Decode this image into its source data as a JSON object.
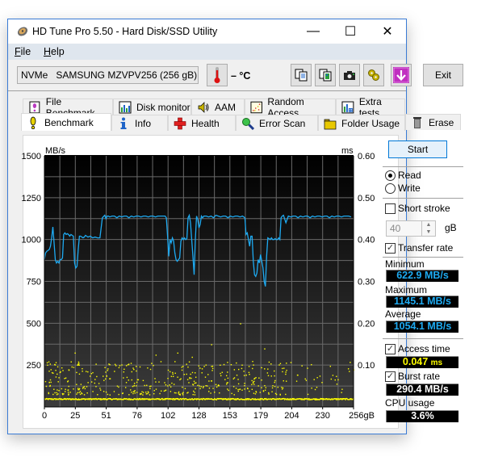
{
  "window": {
    "title": "HD Tune Pro 5.50 - Hard Disk/SSD Utility",
    "controls": {
      "minimize": "—",
      "maximize": "☐",
      "close": "✕"
    }
  },
  "menu": [
    {
      "label": "File",
      "accel": "F",
      "rest": "ile"
    },
    {
      "label": "Help",
      "accel": "H",
      "rest": "elp"
    }
  ],
  "toolbar": {
    "drive": "NVMe   SAMSUNG MZVPV256 (256 gB)",
    "temperature": "– °C",
    "icons": [
      "copy-text-icon",
      "copy-screenshot-icon",
      "camera-icon",
      "options-icon",
      "save-download-icon"
    ],
    "exit_label": "Exit"
  },
  "tabs": {
    "row1": [
      {
        "label": "File Benchmark",
        "icon": "file-benchmark-icon"
      },
      {
        "label": "Disk monitor",
        "icon": "disk-monitor-icon"
      },
      {
        "label": "AAM",
        "icon": "speaker-icon"
      },
      {
        "label": "Random Access",
        "icon": "random-access-icon"
      },
      {
        "label": "Extra tests",
        "icon": "extra-tests-icon"
      }
    ],
    "row2": [
      {
        "label": "Benchmark",
        "icon": "benchmark-icon",
        "active": true
      },
      {
        "label": "Info",
        "icon": "info-icon"
      },
      {
        "label": "Health",
        "icon": "health-cross-icon"
      },
      {
        "label": "Error Scan",
        "icon": "magnifier-icon"
      },
      {
        "label": "Folder Usage",
        "icon": "folder-icon"
      },
      {
        "label": "Erase",
        "icon": "trash-icon"
      }
    ]
  },
  "panel": {
    "start_label": "Start",
    "read_label": "Read",
    "write_label": "Write",
    "mode": "Read",
    "short_stroke_label": "Short stroke",
    "short_stroke_checked": false,
    "short_stroke_value": "40",
    "short_stroke_unit": "gB",
    "transfer_rate_label": "Transfer rate",
    "transfer_rate_checked": true,
    "minimum_label": "Minimum",
    "minimum_value": "622.9 MB/s",
    "maximum_label": "Maximum",
    "maximum_value": "1145.1 MB/s",
    "average_label": "Average",
    "average_value": "1054.1 MB/s",
    "access_time_label": "Access time",
    "access_time_checked": true,
    "access_time_value": "0.047",
    "access_time_unit": "ms",
    "burst_rate_label": "Burst rate",
    "burst_rate_checked": true,
    "burst_rate_value": "290.4 MB/s",
    "cpu_usage_label": "CPU usage",
    "cpu_usage_value": "3.6%"
  },
  "chart_data": {
    "type": "line",
    "title": "",
    "xlabel": "gB",
    "ylabel": "MB/s",
    "y2label": "ms",
    "xlim": [
      0,
      256
    ],
    "ylim": [
      0,
      1500
    ],
    "y2lim": [
      0,
      0.6
    ],
    "x_ticks": [
      "0",
      "25",
      "51",
      "76",
      "102",
      "128",
      "153",
      "179",
      "204",
      "230",
      "256gB"
    ],
    "x_tick_values": [
      0,
      25.6,
      51.2,
      76.8,
      102.4,
      128,
      153.6,
      179.2,
      204.8,
      230.4,
      256
    ],
    "y_ticks": [
      "1500",
      "1250",
      "1000",
      "750",
      "500",
      "250"
    ],
    "y_tick_values": [
      1500,
      1250,
      1000,
      750,
      500,
      250
    ],
    "y2_ticks": [
      "0.60",
      "0.50",
      "0.40",
      "0.30",
      "0.20",
      "0.10"
    ],
    "y2_tick_values": [
      0.6,
      0.5,
      0.4,
      0.3,
      0.2,
      0.1
    ],
    "grid": true,
    "colors": {
      "transfer": "#1eaaf1",
      "access": "#ffff00",
      "bg_top": "#000000",
      "bg_bottom": "#3a3a3a",
      "grid": "#6a6a6a"
    },
    "series": [
      {
        "name": "Transfer rate (MB/s)",
        "x": [
          0,
          1,
          2,
          3,
          4,
          5,
          6,
          7,
          8,
          9,
          10,
          11,
          12,
          13,
          14,
          15,
          16,
          17,
          18,
          19,
          20,
          21,
          22,
          23,
          24,
          25,
          26,
          27,
          28,
          29,
          30,
          31,
          32,
          33,
          34,
          35,
          36,
          38,
          40,
          42,
          44,
          46,
          48,
          50,
          51,
          52,
          53,
          54,
          56,
          58,
          60,
          62,
          64,
          66,
          68,
          70,
          72,
          74,
          76,
          78,
          80,
          82,
          84,
          86,
          88,
          90,
          92,
          94,
          96,
          98,
          100,
          101,
          102,
          103,
          104,
          105,
          106,
          107,
          108,
          109,
          110,
          111,
          112,
          113,
          114,
          115,
          116,
          117,
          118,
          119,
          120,
          121,
          122,
          123,
          124,
          125,
          126,
          127,
          128,
          129,
          130,
          131,
          132,
          134,
          136,
          138,
          140,
          142,
          144,
          146,
          148,
          150,
          152,
          154,
          156,
          158,
          160,
          162,
          164,
          166,
          167,
          168,
          169,
          170,
          171,
          172,
          173,
          174,
          175,
          176,
          177,
          178,
          179,
          180,
          181,
          182,
          183,
          184,
          185,
          186,
          187,
          188,
          189,
          190,
          191,
          192,
          193,
          194,
          195,
          196,
          197,
          198,
          200,
          202,
          204,
          206,
          208,
          210,
          212,
          214,
          216,
          218,
          220,
          222,
          224,
          226,
          228,
          230,
          232,
          234,
          236,
          238,
          240,
          242,
          244,
          246,
          248,
          250,
          252,
          254,
          256
        ],
        "values": [
          880,
          920,
          930,
          935,
          940,
          960,
          1010,
          1075,
          980,
          880,
          860,
          870,
          860,
          880,
          880,
          890,
          1030,
          1040,
          1030,
          1035,
          1030,
          1020,
          1030,
          1025,
          1020,
          860,
          830,
          840,
          940,
          1020,
          1020,
          1015,
          1010,
          1015,
          1025,
          1020,
          1015,
          1020,
          1010,
          1015,
          1010,
          1010,
          1130,
          1145,
          1125,
          1140,
          1140,
          1135,
          1140,
          1140,
          1130,
          1140,
          1135,
          1140,
          1140,
          1130,
          1140,
          1135,
          1140,
          1140,
          1135,
          1140,
          1140,
          1135,
          1140,
          1140,
          1135,
          1140,
          1140,
          1140,
          1140,
          1130,
          1020,
          900,
          1000,
          980,
          1010,
          990,
          920,
          880,
          870,
          880,
          890,
          990,
          1010,
          1000,
          1010,
          1000,
          1005,
          1130,
          1145,
          1100,
          1000,
          900,
          790,
          1000,
          1140,
          1120,
          1070,
          1090,
          1140,
          1130,
          1140,
          1140,
          1135,
          1140,
          1130,
          1145,
          1140,
          1135,
          1140,
          1140,
          1130,
          1140,
          1135,
          1140,
          1140,
          1135,
          1140,
          1130,
          1030,
          1040,
          1000,
          960,
          1020,
          1020,
          870,
          790,
          780,
          800,
          880,
          860,
          910,
          870,
          830,
          750,
          720,
          900,
          1010,
          1005,
          1000,
          1010,
          1000,
          1000,
          1005,
          1000,
          1000,
          1010,
          1000,
          1130,
          1140,
          1145,
          1100,
          1140,
          1135,
          1140,
          1140,
          1130,
          1140,
          1135,
          1140,
          1140,
          1130,
          1140,
          1135,
          1140,
          1140,
          1135,
          1140,
          1140,
          1130,
          1140,
          1135,
          1140,
          1140,
          1135,
          1140,
          1140,
          1140,
          1135
        ]
      },
      {
        "name": "Access time (ms)",
        "type": "scatter",
        "note": "~800 points, dense band near 0.02 ms and scattered between 0.03–0.11 ms, a few outliers up to 0.2 ms",
        "band_value": 0.02,
        "scatter_range": [
          0.03,
          0.11
        ],
        "outliers": [
          [
            25,
            0.13
          ],
          [
            92,
            0.125
          ],
          [
            110,
            0.13
          ],
          [
            122,
            0.12
          ],
          [
            138,
            0.15
          ],
          [
            162,
            0.2
          ],
          [
            172,
            0.11
          ],
          [
            182,
            0.14
          ],
          [
            195,
            0.105
          ]
        ]
      }
    ]
  }
}
